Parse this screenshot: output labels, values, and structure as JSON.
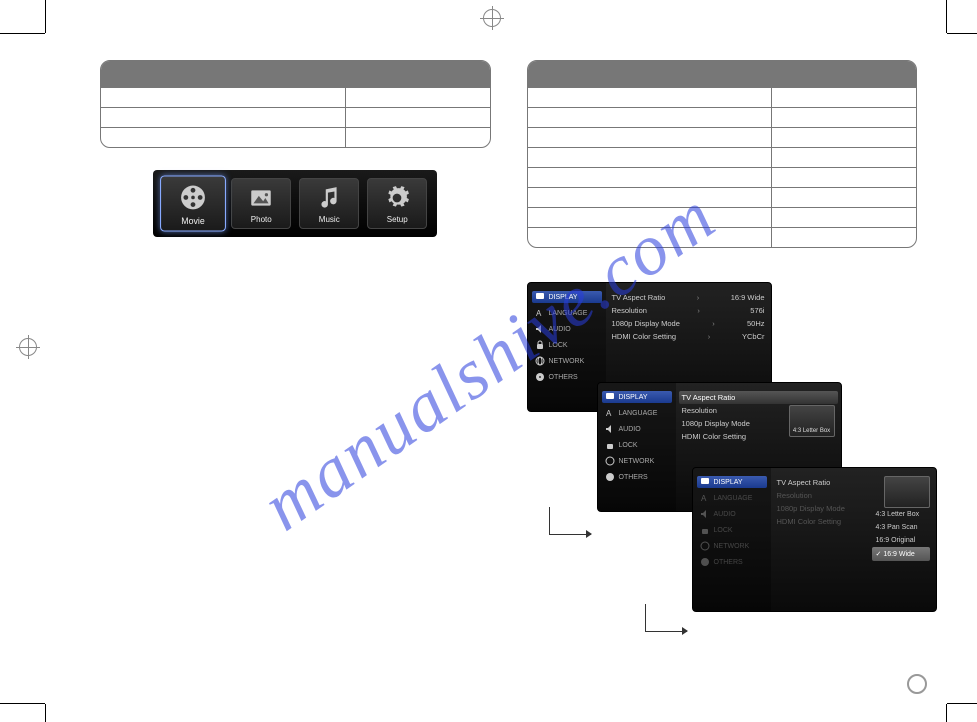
{
  "watermark": "manualshive.com",
  "home_menu": {
    "items": [
      {
        "name": "movie-item",
        "icon": "film-reel-icon",
        "label": "Movie",
        "selected": true
      },
      {
        "name": "photo-item",
        "icon": "photo-icon",
        "label": "Photo",
        "selected": false
      },
      {
        "name": "music-item",
        "icon": "music-icon",
        "label": "Music",
        "selected": false
      },
      {
        "name": "setup-item",
        "icon": "gear-icon",
        "label": "Setup",
        "selected": false
      }
    ]
  },
  "left_table": {
    "rows": 3
  },
  "right_table": {
    "rows": 8
  },
  "osd": {
    "sidebar": [
      {
        "key": "display",
        "label": "DISPLAY",
        "icon": "monitor-icon"
      },
      {
        "key": "language",
        "label": "LANGUAGE",
        "icon": "letter-a-icon"
      },
      {
        "key": "audio",
        "label": "AUDIO",
        "icon": "speaker-icon"
      },
      {
        "key": "lock",
        "label": "LOCK",
        "icon": "lock-icon"
      },
      {
        "key": "network",
        "label": "NETWORK",
        "icon": "network-icon"
      },
      {
        "key": "others",
        "label": "OTHERS",
        "icon": "disc-icon"
      }
    ],
    "screen1": {
      "rows": [
        {
          "label": "TV Aspect Ratio",
          "value": "16:9 Wide"
        },
        {
          "label": "Resolution",
          "value": "576i"
        },
        {
          "label": "1080p Display Mode",
          "value": "50Hz"
        },
        {
          "label": "HDMI Color Setting",
          "value": "YCbCr"
        }
      ]
    },
    "screen2": {
      "rows": [
        {
          "label": "TV Aspect Ratio",
          "active": true
        },
        {
          "label": "Resolution"
        },
        {
          "label": "1080p Display Mode"
        },
        {
          "label": "HDMI Color Setting"
        }
      ],
      "preview_label": "4:3 Letter Box"
    },
    "screen3": {
      "rows": [
        {
          "label": "TV Aspect Ratio"
        },
        {
          "label": "Resolution",
          "dim": true
        },
        {
          "label": "1080p Display Mode",
          "dim": true
        },
        {
          "label": "HDMI Color Setting",
          "dim": true
        }
      ],
      "options": [
        {
          "label": "4:3 Letter Box"
        },
        {
          "label": "4:3 Pan Scan"
        },
        {
          "label": "16:9 Original"
        },
        {
          "label": "16:9 Wide",
          "selected": true
        }
      ]
    }
  }
}
